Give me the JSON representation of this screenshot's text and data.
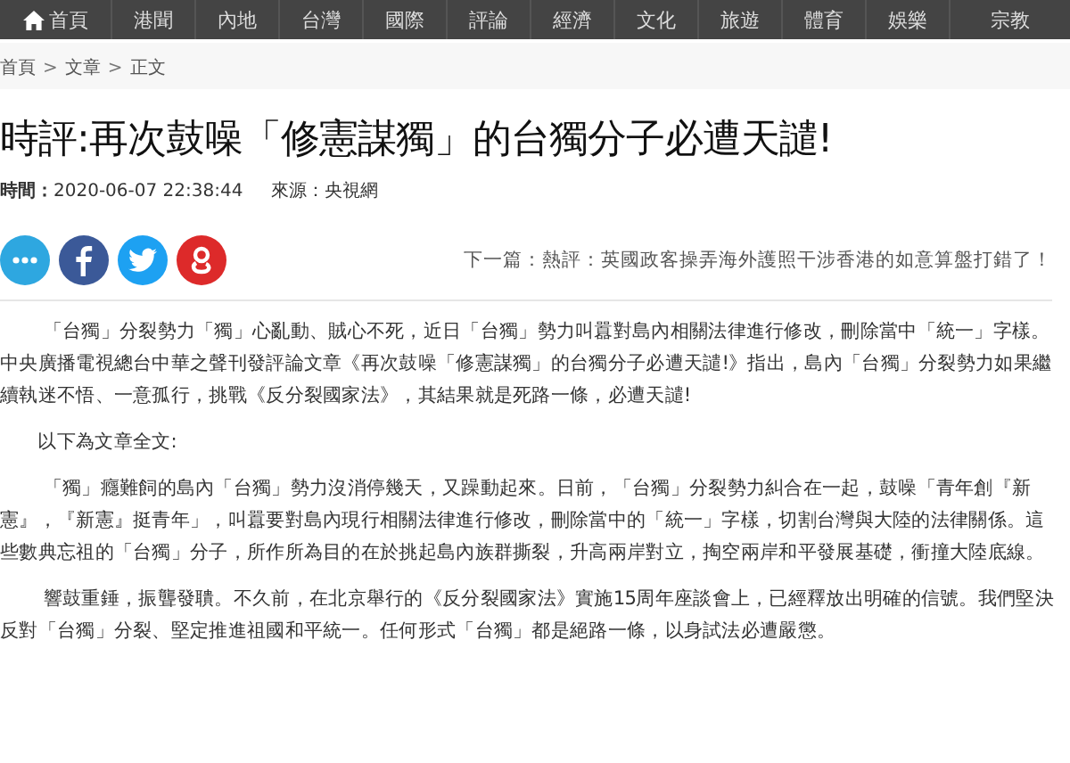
{
  "nav": [
    {
      "label": "首頁",
      "home": true
    },
    {
      "label": "港聞",
      "home": false
    },
    {
      "label": "內地",
      "home": false
    },
    {
      "label": "台灣",
      "home": false
    },
    {
      "label": "國際",
      "home": false
    },
    {
      "label": "評論",
      "home": false
    },
    {
      "label": "經濟",
      "home": false
    },
    {
      "label": "文化",
      "home": false
    },
    {
      "label": "旅遊",
      "home": false
    },
    {
      "label": "體育",
      "home": false
    },
    {
      "label": "娛樂",
      "home": false
    },
    {
      "label": "宗教",
      "home": false
    }
  ],
  "breadcrumb": [
    "首頁",
    "文章",
    "正文"
  ],
  "breadcrumb_separator": ">",
  "title": "時評:再次鼓噪「修憲謀獨」的台獨分子必遭天譴!",
  "meta": {
    "time_label": "時間：",
    "time": "2020-06-07 22:38:44",
    "source": "來源：央視網"
  },
  "share": [
    {
      "kind": "chat",
      "color": "#2ea7e0"
    },
    {
      "kind": "facebook",
      "color": "#3b5998"
    },
    {
      "kind": "twitter",
      "color": "#1da1f2"
    },
    {
      "kind": "google",
      "color": "#dd2a2a"
    }
  ],
  "next_article": "下一篇：熱評：英國政客操弄海外護照干涉香港的如意算盤打錯了！",
  "paragraphs": [
    "「台獨」分裂勢力「獨」心亂動、賊心不死，近日「台獨」勢力叫囂對島內相關法律進行修改，刪除當中「統一」字樣。中央廣播電視總台中華之聲刊發評論文章《再次鼓噪「修憲謀獨」的台獨分子必遭天譴!》指出，島內「台獨」分裂勢力如果繼續執迷不悟、一意孤行，挑戰《反分裂國家法》，其結果就是死路一條，必遭天譴!",
    "以下為文章全文:",
    "「獨」癮難飼的島內「台獨」勢力沒消停幾天，又躁動起來。日前，「台獨」分裂勢力糾合在一起，鼓噪「青年創『新憲』，『新憲』挺青年」，叫囂要對島內現行相關法律進行修改，刪除當中的「統一」字樣，切割台灣與大陸的法律關係。這些數典忘祖的「台獨」分子，所作所為目的在於挑起島內族群撕裂，升高兩岸對立，掏空兩岸和平發展基礎，衝撞大陸底線。",
    "響鼓重錘，振聾發聵。不久前，在北京舉行的《反分裂國家法》實施15周年座談會上，已經釋放出明確的信號。我們堅決反對「台獨」分裂、堅定推進祖國和平統一。任何形式「台獨」都是絕路一條，以身試法必遭嚴懲。"
  ]
}
